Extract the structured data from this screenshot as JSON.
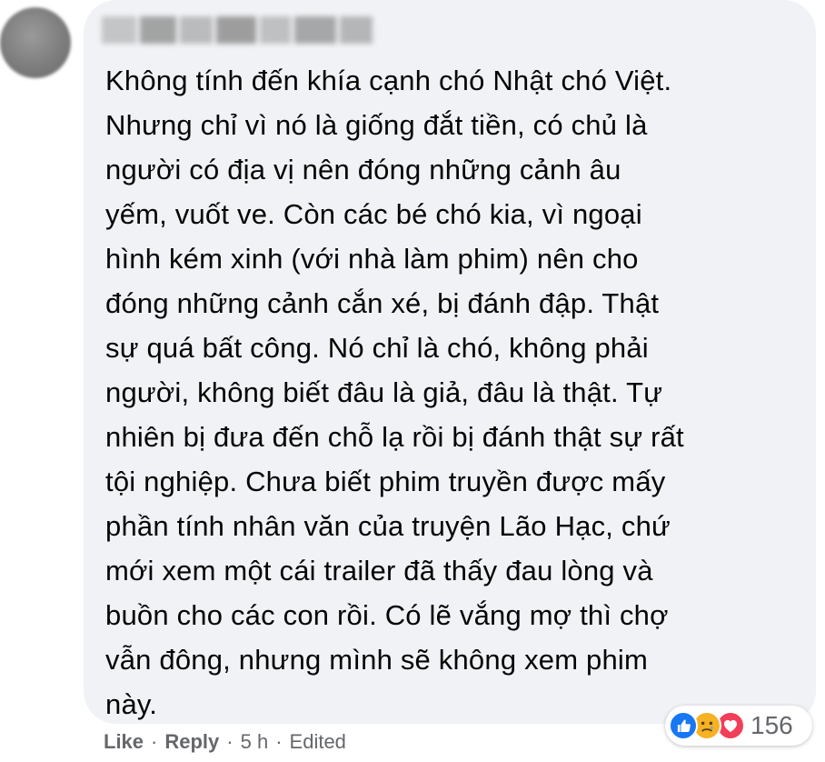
{
  "comment": {
    "text": "Không tính đến khía cạnh chó Nhật chó Việt.\nNhưng chỉ vì nó là giống đắt tiền, có chủ là\nngười có địa vị nên đóng những cảnh âu\nyếm, vuốt ve. Còn các bé chó kia, vì ngoại\nhình kém xinh (với nhà làm phim) nên cho\nđóng những cảnh cắn xé, bị đánh đập. Thật\nsự quá bất công. Nó chỉ là chó, không phải\nngười, không biết đâu là giả, đâu là thật. Tự\nnhiên bị đưa đến chỗ lạ rồi bị đánh thật sự rất\ntội nghiệp. Chưa biết phim truyền được mấy\nphần tính nhân văn của truyện Lão Hạc, chứ\nmới xem một cái trailer đã thấy đau lòng và\nbuồn cho các con rồi. Có lẽ vắng mợ thì chợ\nvẫn đông, nhưng mình sẽ không xem phim\nnày."
  },
  "actions": {
    "like": "Like",
    "separator": "·",
    "reply": "Reply",
    "time": "5 h",
    "edited": "Edited"
  },
  "reactions": {
    "icons": [
      "like-icon",
      "sad-icon",
      "love-icon"
    ],
    "count": "156"
  },
  "colors": {
    "bubble": "#f0f2f5",
    "text": "#050505",
    "meta": "#65676b",
    "like": "#1877f2",
    "sad": "#f7b125",
    "love": "#f33e58"
  }
}
